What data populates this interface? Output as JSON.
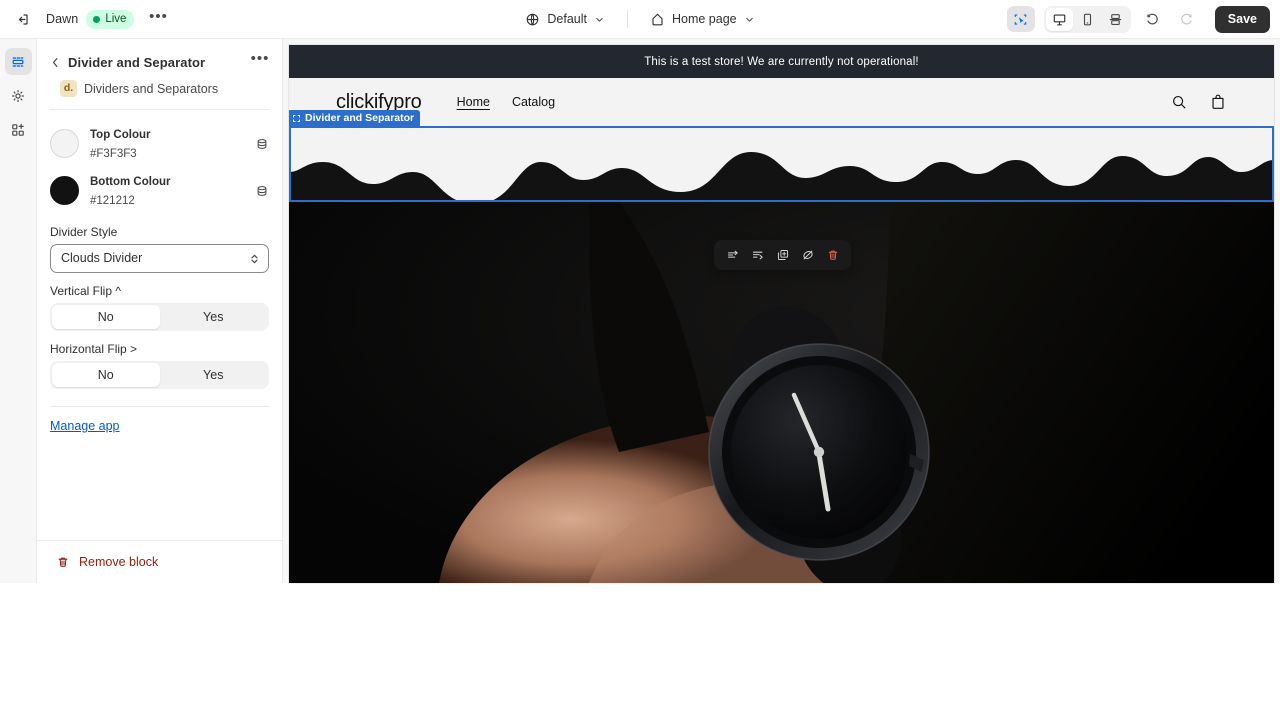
{
  "topbar": {
    "exit_icon": "exit-icon",
    "theme_name": "Dawn",
    "status_label": "Live",
    "more_label": "•••",
    "locale_icon": "globe-icon",
    "locale_label": "Default",
    "page_icon": "home-icon",
    "page_label": "Home page",
    "select_tool_icon": "select-tool-icon",
    "devices": [
      {
        "name": "desktop",
        "icon": "desktop-icon",
        "active": true
      },
      {
        "name": "mobile",
        "icon": "mobile-icon",
        "active": false
      },
      {
        "name": "fullscreen",
        "icon": "fullscreen-icon",
        "active": false
      }
    ],
    "undo_icon": "undo-icon",
    "redo_icon": "redo-icon",
    "save_label": "Save"
  },
  "rail": {
    "items": [
      {
        "name": "sections",
        "icon": "sections-icon",
        "active": true
      },
      {
        "name": "settings",
        "icon": "gear-icon",
        "active": false
      },
      {
        "name": "apps",
        "icon": "apps-add-icon",
        "active": false
      }
    ]
  },
  "sidebar": {
    "back_icon": "chevron-left-icon",
    "title": "Divider and Separator",
    "more_label": "•••",
    "app_badge": "d.",
    "app_name": "Dividers and Separators",
    "colors": [
      {
        "label": "Top Colour",
        "value": "#F3F3F3",
        "swatch": "#F3F3F3",
        "icon": "database-icon"
      },
      {
        "label": "Bottom Colour",
        "value": "#121212",
        "swatch": "#121212",
        "icon": "database-icon"
      }
    ],
    "divider_style": {
      "label": "Divider Style",
      "value": "Clouds Divider",
      "options": [
        "Clouds Divider"
      ]
    },
    "vertical_flip": {
      "label": "Vertical Flip ^",
      "options": [
        "No",
        "Yes"
      ],
      "selected": "No"
    },
    "horizontal_flip": {
      "label": "Horizontal Flip >",
      "options": [
        "No",
        "Yes"
      ],
      "selected": "No"
    },
    "manage_app_label": "Manage app",
    "remove_block_label": "Remove block",
    "remove_block_icon": "trash-icon"
  },
  "preview": {
    "announcement": "This is a test store! We are currently not operational!",
    "store_logo": "clickifypro",
    "nav": [
      {
        "label": "Home",
        "active": true
      },
      {
        "label": "Catalog",
        "active": false
      }
    ],
    "search_icon": "search-icon",
    "cart_icon": "cart-icon",
    "selected_block": {
      "tag_icon": "block-frame-icon",
      "tag_label": "Divider and Separator",
      "top_colour": "#F3F3F3",
      "bottom_colour": "#121212",
      "style": "Clouds Divider"
    },
    "block_toolbar": [
      {
        "name": "move-up-button",
        "icon": "move-up-icon"
      },
      {
        "name": "move-down-button",
        "icon": "move-down-icon"
      },
      {
        "name": "duplicate-button",
        "icon": "duplicate-icon"
      },
      {
        "name": "hide-button",
        "icon": "eye-slash-icon"
      },
      {
        "name": "delete-button",
        "icon": "trash-icon"
      }
    ]
  }
}
